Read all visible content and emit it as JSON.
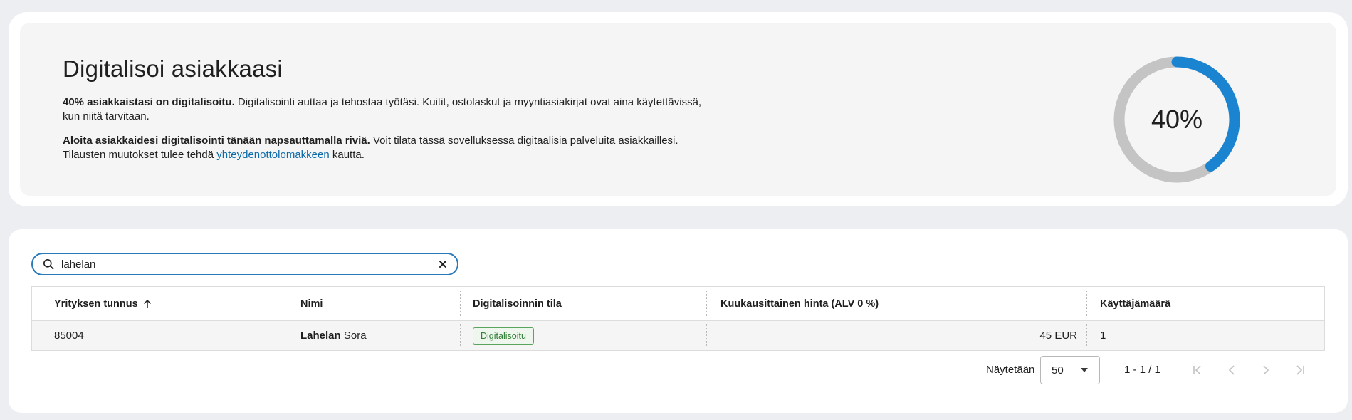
{
  "intro": {
    "title": "Digitalisoi asiakkaasi",
    "p1_bold": "40% asiakkaistasi on digitalisoitu.",
    "p1_text_line1": " Digitalisointi auttaa ja tehostaa työtäsi. Kuitit, ostolaskut ja myyntiasiakirjat ovat aina käytettävissä,",
    "p1_text_line2": "kun niitä tarvitaan.",
    "p2_bold": "Aloita asiakkaidesi digitalisointi tänään napsauttamalla riviä.",
    "p2_text_line1": " Voit tilata tässä sovelluksessa digitaalisia palveluita asiakkaillesi.",
    "p2_text_line2_pre": "Tilausten muutokset tulee tehdä ",
    "p2_link": "yhteydenottolomakkeen",
    "p2_text_line2_post": " kautta.",
    "progress_label": "40%",
    "progress_fraction": 0.4,
    "progress_color": "#1a84d0",
    "track_color": "#c4c4c4"
  },
  "search": {
    "value": "lahelan",
    "icon": "search-icon",
    "clear_icon": "close-icon"
  },
  "table": {
    "columns": [
      "Yrityksen tunnus",
      "Nimi",
      "Digitalisoinnin tila",
      "Kuukausittainen hinta (ALV 0 %)",
      "Käyttäjämäärä"
    ],
    "sort_icon": "arrow-up-icon",
    "rows": [
      {
        "id": "85004",
        "name_bold": "Lahelan",
        "name_rest": " Sora",
        "status": "Digitalisoitu",
        "price": "45 EUR",
        "users": "1"
      }
    ]
  },
  "pager": {
    "show_label": "Näytetään",
    "page_size": "50",
    "range": "1 - 1 / 1",
    "icons": [
      "first-page-icon",
      "previous-page-icon",
      "next-page-icon",
      "last-page-icon"
    ]
  }
}
